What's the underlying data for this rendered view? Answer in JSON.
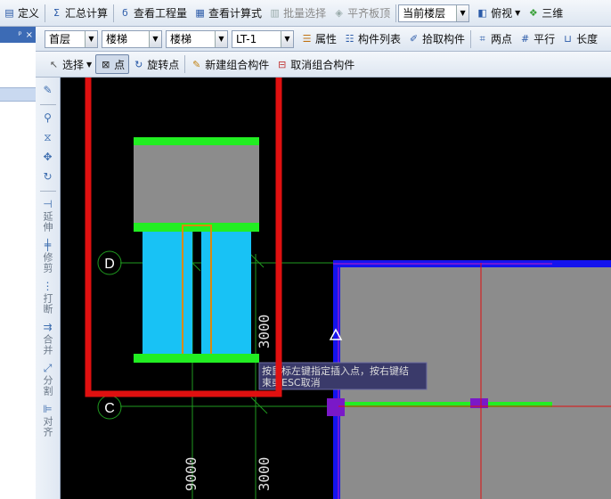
{
  "toolbar1": {
    "define": "定义",
    "summary": "汇总计算",
    "view_quantity": "查看工程量",
    "view_formula": "查看计算式",
    "batch_select": "批量选择",
    "align_slab_top": "平齐板顶",
    "floor_scope": "当前楼层",
    "view_mode": "俯视",
    "three_d": "三维"
  },
  "left_panel": {
    "pin": "ᵖ",
    "close": "×"
  },
  "toolbar2": {
    "floor": "首层",
    "category": "楼梯",
    "type": "楼梯",
    "component": "LT-1",
    "property": "属性",
    "component_list": "构件列表",
    "pick_component": "拾取构件",
    "two_point": "两点",
    "parallel": "平行",
    "length": "长度"
  },
  "toolbar3": {
    "select": "选择",
    "point": "点",
    "rotate_point": "旋转点",
    "new_group": "新建组合构件",
    "cancel_group": "取消组合构件"
  },
  "vertical_tools": [
    "延伸",
    "修剪",
    "打断",
    "合并",
    "分割",
    "对齐"
  ],
  "canvas": {
    "axis_d": "D",
    "axis_c": "C",
    "dim_3000_a": "3000",
    "dim_3000_b": "3000",
    "dim_9000": "9000",
    "tooltip_line1": "按鼠标左键指定插入点，按右键结",
    "tooltip_line2": "束或ESC取消"
  },
  "colors": {
    "annotation_red": "#e01010",
    "stair_cyan": "#18c2f5",
    "landing_gray": "#8c8c8c",
    "edge_green": "#22ee22",
    "wall_blue": "#1414ee",
    "axis_green": "#1f9a1f"
  }
}
